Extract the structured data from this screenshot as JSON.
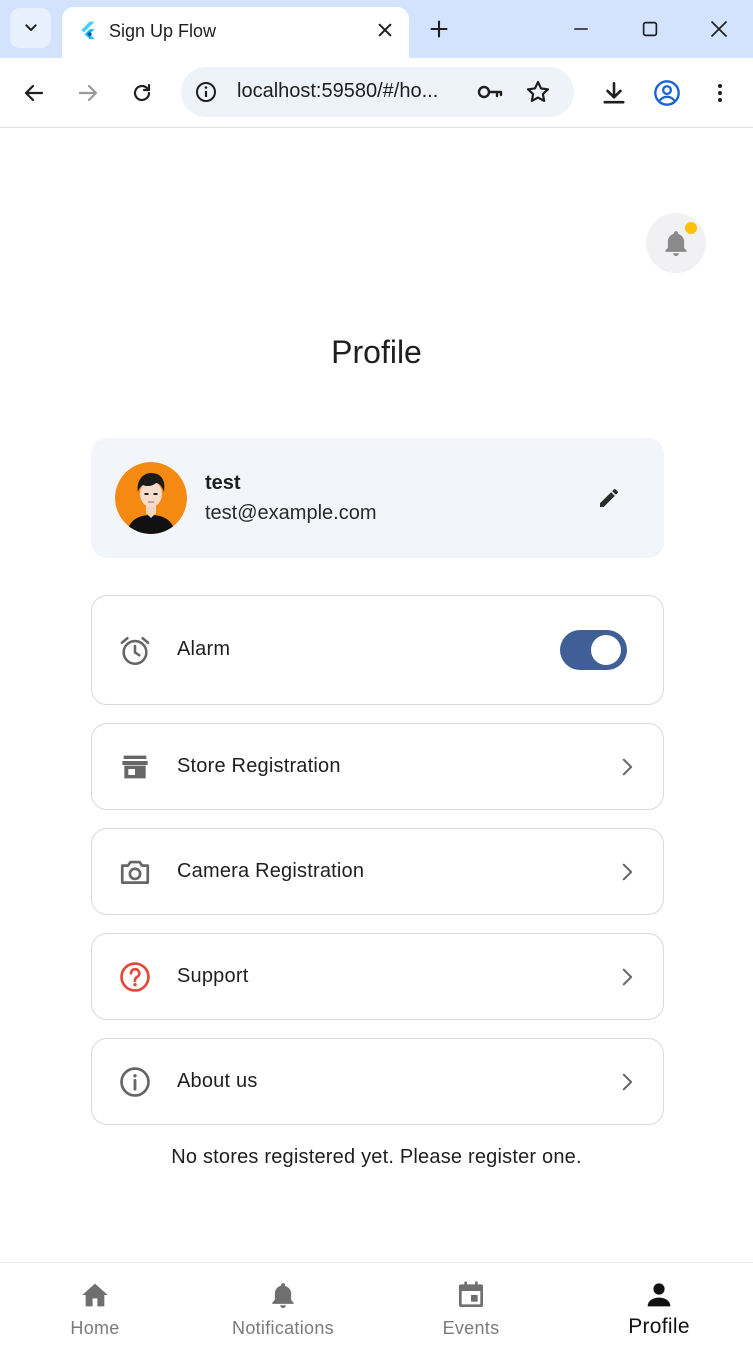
{
  "browser": {
    "tab_title": "Sign Up Flow",
    "url": "localhost:59580/#/ho..."
  },
  "app": {
    "page_title": "Profile",
    "profile": {
      "name": "test",
      "email": "test@example.com"
    },
    "menu": {
      "alarm": {
        "label": "Alarm",
        "toggle_on": true
      },
      "store": {
        "label": "Store Registration"
      },
      "camera": {
        "label": "Camera Registration"
      },
      "support": {
        "label": "Support"
      },
      "about": {
        "label": "About us"
      }
    },
    "empty_note": "No stores registered yet. Please register one.",
    "bottom_nav": {
      "home": "Home",
      "notifications": "Notifications",
      "events": "Events",
      "profile": "Profile",
      "active": "profile"
    }
  },
  "colors": {
    "accent": "#3f5f96",
    "notification_dot": "#ffc107",
    "support_icon": "#e5483b",
    "avatar_bg": "#f58a13"
  },
  "icons": {
    "tab_search": "chevron-down-icon",
    "favicon": "flutter-icon",
    "notifications": "bell-icon",
    "edit": "pencil-icon",
    "alarm": "alarm-clock-icon",
    "store": "storefront-icon",
    "camera": "camera-icon",
    "support": "help-circle-icon",
    "about": "info-icon"
  }
}
